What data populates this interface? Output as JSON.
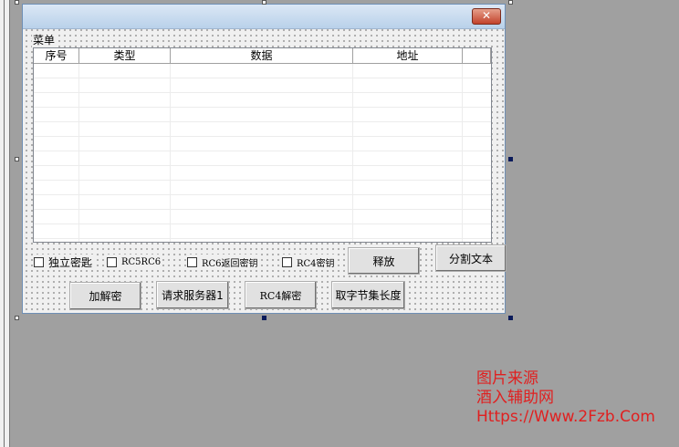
{
  "window": {
    "close_glyph": "✕",
    "menu_label": "菜单"
  },
  "list": {
    "columns": [
      "序号",
      "类型",
      "数据",
      "地址",
      ""
    ]
  },
  "checkboxes": [
    {
      "label": "独立密匙",
      "checked": false
    },
    {
      "label": "RC5RC6",
      "checked": false
    },
    {
      "label": "RC6返回密钥",
      "checked": false
    },
    {
      "label": "RC4密钥",
      "checked": false
    }
  ],
  "buttons": {
    "release": "释放",
    "split_text": "分割文本",
    "encrypt_decrypt": "加解密",
    "request_server": "请求服务器1",
    "rc4_decrypt": "RC4解密",
    "byte_set_length": "取字节集长度"
  },
  "watermark": {
    "line1": "图片来源",
    "line2": "酒入辅助网",
    "line3": "Https://Www.2Fzb.Com"
  }
}
